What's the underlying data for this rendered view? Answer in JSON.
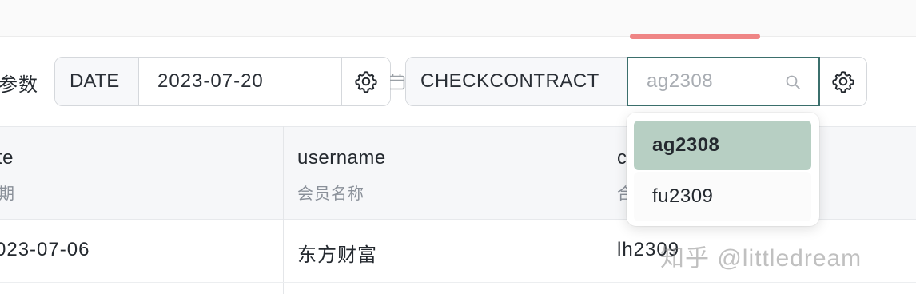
{
  "params": {
    "label": "参数"
  },
  "date_filter": {
    "addon_label": "DATE",
    "value": "2023-07-20",
    "icons": {
      "calendar": "calendar-icon",
      "settings": "gear-icon"
    }
  },
  "contract_filter": {
    "addon_label": "CHECKCONTRACT",
    "placeholder": "ag2308",
    "icons": {
      "search": "search-icon",
      "settings": "gear-icon"
    }
  },
  "dropdown": {
    "options": [
      {
        "label": "ag2308",
        "selected": true
      },
      {
        "label": "fu2309",
        "selected": false
      }
    ]
  },
  "table": {
    "columns": [
      {
        "field": "te",
        "title": "期"
      },
      {
        "field": "username",
        "title": "会员名称"
      },
      {
        "field": "c",
        "title": "合"
      }
    ],
    "rows": [
      [
        "023-07-06",
        "东方财富",
        "lh2309"
      ]
    ]
  },
  "watermark": {
    "text": "知乎 @littledream"
  },
  "colors": {
    "accent": "#3b6f6c",
    "selected_option_bg": "#b7cfc3",
    "tab_indicator": "#ef8585"
  }
}
